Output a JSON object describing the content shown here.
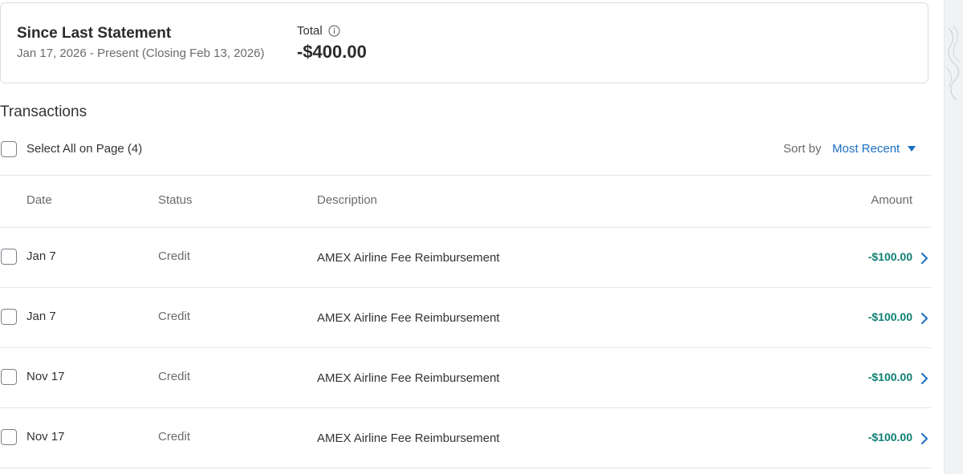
{
  "summary": {
    "title": "Since Last Statement",
    "range": "Jan 17, 2026 - Present (Closing Feb 13, 2026)",
    "total_label": "Total",
    "total_amount": "-$400.00"
  },
  "transactions": {
    "title": "Transactions",
    "select_all_label": "Select All on Page (4)",
    "sort_label": "Sort by",
    "sort_value": "Most Recent",
    "columns": {
      "date": "Date",
      "status": "Status",
      "description": "Description",
      "amount": "Amount"
    },
    "rows": [
      {
        "date": "Jan 7",
        "status": "Credit",
        "description": "AMEX Airline Fee Reimbursement",
        "amount": "-$100.00"
      },
      {
        "date": "Jan 7",
        "status": "Credit",
        "description": "AMEX Airline Fee Reimbursement",
        "amount": "-$100.00"
      },
      {
        "date": "Nov 17",
        "status": "Credit",
        "description": "AMEX Airline Fee Reimbursement",
        "amount": "-$100.00"
      },
      {
        "date": "Nov 17",
        "status": "Credit",
        "description": "AMEX Airline Fee Reimbursement",
        "amount": "-$100.00"
      }
    ]
  },
  "colors": {
    "accent": "#1a6fc2",
    "credit_amount": "#0e8073",
    "border": "#d9dde1"
  },
  "icons": {
    "info": "info-icon",
    "sort_caret": "caret-down-icon",
    "row_chevron": "chevron-right-icon"
  }
}
